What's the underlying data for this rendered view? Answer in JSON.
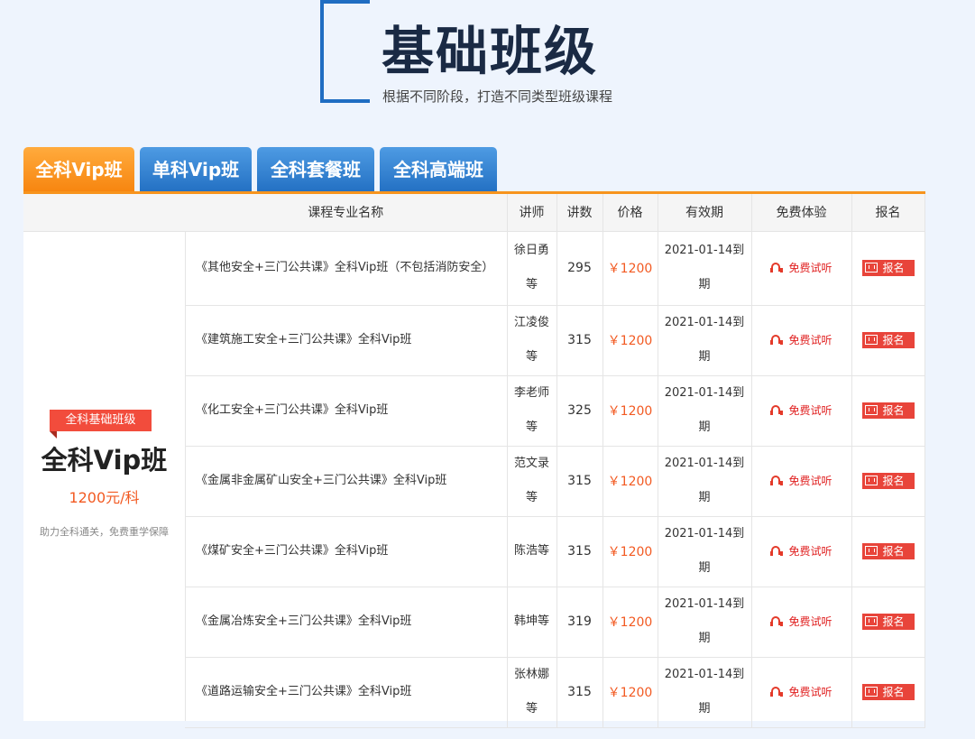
{
  "header": {
    "title": "基础班级",
    "subtitle": "根据不同阶段，打造不同类型班级课程"
  },
  "tabs": [
    {
      "label": "全科Vip班",
      "active": true
    },
    {
      "label": "单科Vip班",
      "active": false
    },
    {
      "label": "全科套餐班",
      "active": false
    },
    {
      "label": "全科高端班",
      "active": false
    }
  ],
  "package": {
    "badge": "全科基础班级",
    "name": "全科Vip班",
    "price": "1200元/科",
    "note": "助力全科通关，免费重学保障"
  },
  "table": {
    "headers": [
      "课程专业名称",
      "讲师",
      "讲数",
      "价格",
      "有效期",
      "免费体验",
      "报名"
    ],
    "trial_label": "免费试听",
    "signup_label": "报名",
    "rows": [
      {
        "name": "《其他安全+三门公共课》全科Vip班（不包括消防安全）",
        "teacher": "徐日勇等",
        "lectures": "295",
        "price": "￥1200",
        "valid": "2021-01-14到期"
      },
      {
        "name": "《建筑施工安全+三门公共课》全科Vip班",
        "teacher": "江凌俊等",
        "lectures": "315",
        "price": "￥1200",
        "valid": "2021-01-14到期"
      },
      {
        "name": "《化工安全+三门公共课》全科Vip班",
        "teacher": "李老师等",
        "lectures": "325",
        "price": "￥1200",
        "valid": "2021-01-14到期"
      },
      {
        "name": "《金属非金属矿山安全+三门公共课》全科Vip班",
        "teacher": "范文录等",
        "lectures": "315",
        "price": "￥1200",
        "valid": "2021-01-14到期"
      },
      {
        "name": "《煤矿安全+三门公共课》全科Vip班",
        "teacher": "陈浩等",
        "lectures": "315",
        "price": "￥1200",
        "valid": "2021-01-14到期"
      },
      {
        "name": "《金属冶炼安全+三门公共课》全科Vip班",
        "teacher": "韩坤等",
        "lectures": "319",
        "price": "￥1200",
        "valid": "2021-01-14到期"
      },
      {
        "name": "《道路运输安全+三门公共课》全科Vip班",
        "teacher": "张林娜等",
        "lectures": "315",
        "price": "￥1200",
        "valid": "2021-01-14到期"
      }
    ]
  },
  "colors": {
    "accent_orange": "#f7941d",
    "tab_blue": "#2370c3",
    "price_red": "#f25a22",
    "title_dark": "#1a2a44"
  }
}
